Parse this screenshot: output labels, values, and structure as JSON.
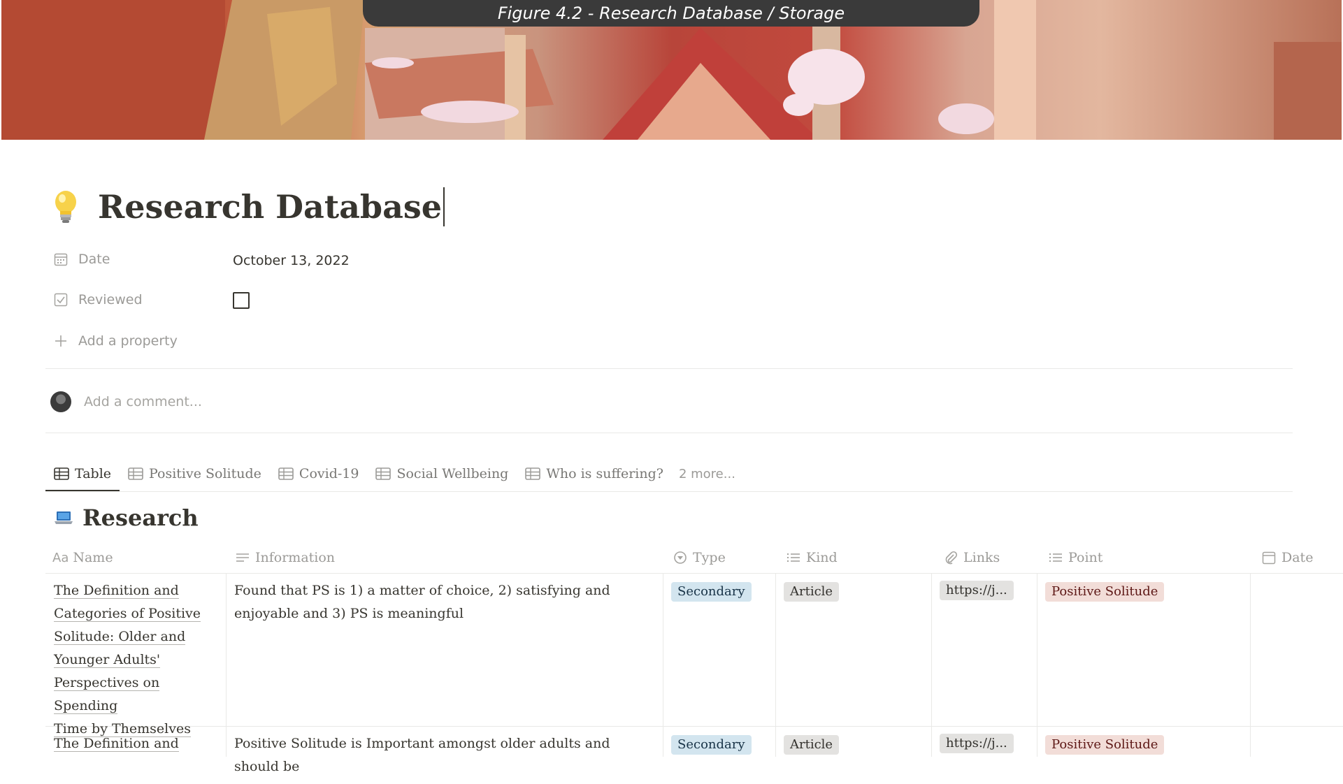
{
  "caption": "Figure 4.2 - Research Database / Storage",
  "page": {
    "icon": "lightbulb-icon",
    "title": "Research Database"
  },
  "properties": [
    {
      "icon": "calendar-icon",
      "label": "Date",
      "value": "October 13, 2022"
    },
    {
      "icon": "checkbox-icon",
      "label": "Reviewed",
      "checked": false
    }
  ],
  "add_property": "Add a property",
  "comment_placeholder": "Add a comment...",
  "tabs": [
    {
      "label": "Table",
      "active": true
    },
    {
      "label": "Positive Solitude"
    },
    {
      "label": "Covid-19"
    },
    {
      "label": "Social Wellbeing"
    },
    {
      "label": "Who is suffering?"
    }
  ],
  "tabs_more": "2 more...",
  "database": {
    "icon": "laptop-icon",
    "title": "Research",
    "columns": [
      {
        "icon": "text-aa-icon",
        "label": "Name"
      },
      {
        "icon": "lines-icon",
        "label": "Information"
      },
      {
        "icon": "select-circle-icon",
        "label": "Type"
      },
      {
        "icon": "list-icon",
        "label": "Kind"
      },
      {
        "icon": "paperclip-icon",
        "label": "Links"
      },
      {
        "icon": "list-icon",
        "label": "Point"
      },
      {
        "icon": "calendar-icon",
        "label": "Date"
      }
    ],
    "rows": [
      {
        "name": "The Definition and Categories of Positive Solitude: Older and Younger Adults' Perspectives on Spending Time by Themselves",
        "name_lines": [
          "The Definition and",
          "Categories of Positive",
          "Solitude: Older and",
          "Younger Adults'",
          "Perspectives on Spending",
          "Time by Themselves"
        ],
        "information": "Found that PS is 1) a matter of choice, 2) satisfying and enjoyable and 3) PS is meaningful",
        "type": "Secondary",
        "kind": "Article",
        "links": "https://j...",
        "point": "Positive Solitude"
      },
      {
        "name_lines": [
          "The Definition and"
        ],
        "information": "Positive Solitude is Important amongst older adults and should be",
        "type": "Secondary",
        "kind": "Article",
        "links": "https://j...",
        "point": "Positive Solitude"
      }
    ]
  },
  "colors": {
    "text": "#37352f",
    "muted": "#9b9a97",
    "tag_blue": "#d3e5ef",
    "tag_gray": "#e3e2e0",
    "tag_pink": "#f2ddd8",
    "caption_bg": "#3a3a3a"
  }
}
